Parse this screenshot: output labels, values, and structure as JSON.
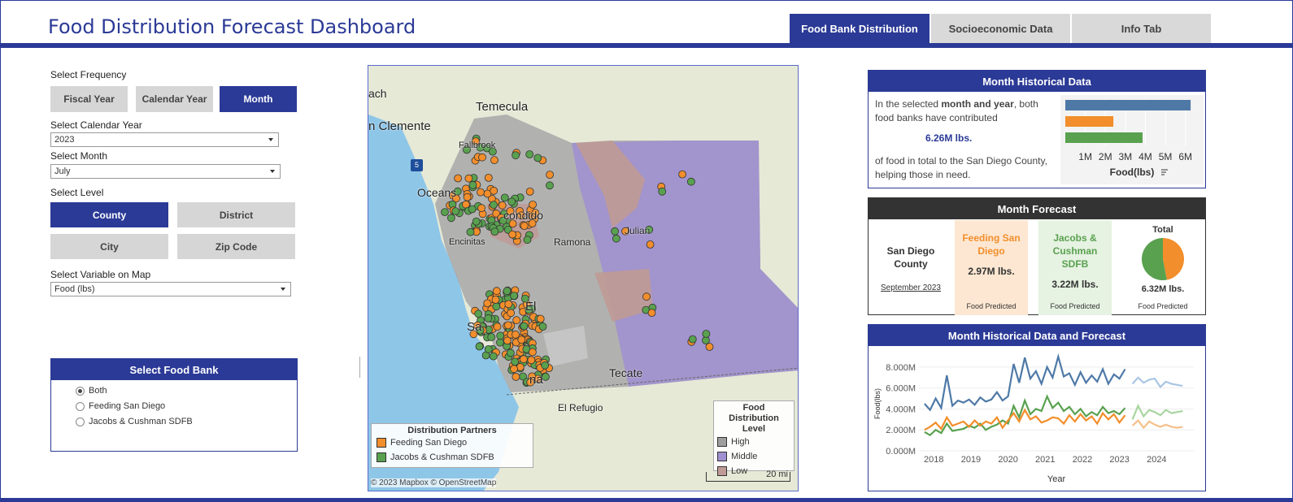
{
  "header": {
    "title": "Food Distribution Forecast Dashboard",
    "tabs": [
      {
        "label": "Food Bank Distribution",
        "active": true
      },
      {
        "label": "Socioeconomic Data",
        "active": false
      },
      {
        "label": "Info Tab",
        "active": false
      }
    ]
  },
  "controls": {
    "frequency_label": "Select Frequency",
    "frequency_options": [
      "Fiscal Year",
      "Calendar Year",
      "Month"
    ],
    "frequency_selected": "Month",
    "year_label": "Select Calendar Year",
    "year_value": "2023",
    "month_label": "Select Month",
    "month_value": "July",
    "level_label": "Select Level",
    "level_options": [
      "County",
      "District",
      "City",
      "Zip Code"
    ],
    "level_selected": "County",
    "variable_label": "Select Variable on Map",
    "variable_value": "Food (lbs)"
  },
  "food_bank": {
    "title": "Select Food Bank",
    "options": [
      "Both",
      "Feeding San Diego",
      "Jacobs & Cushman SDFB"
    ],
    "selected": "Both"
  },
  "map": {
    "places": {
      "temecula": "Temecula",
      "san_clemente": "n Clemente",
      "fallbrook": "Fallbrook",
      "oceanside": "Oceans",
      "escondido": "condido",
      "encinitas": "Encinitas",
      "ramona": "Ramona",
      "julian": "Julian",
      "el_cajon": "El",
      "san_diego": "Sa",
      "chula": "na",
      "tecate": "Tecate",
      "el_refugio": "El Refugio",
      "beach": "ach"
    },
    "interstate": "5",
    "partners_legend": {
      "title": "Distribution Partners",
      "items": [
        "Feeding San Diego",
        "Jacobs & Cushman SDFB"
      ]
    },
    "level_legend": {
      "title_line1": "Food Distribution",
      "title_line2": "Level",
      "items": [
        "High",
        "Middle",
        "Low"
      ]
    },
    "scale": "20 mi",
    "attribution": "© 2023 Mapbox  © OpenStreetMap",
    "colors": {
      "feeding": "#f28e2b",
      "jacobs": "#59a14f",
      "high": "#9e9e9e",
      "middle": "#a08fd1",
      "low": "#c09a95"
    }
  },
  "historical": {
    "title": "Month Historical Data",
    "text_before": "In the selected ",
    "text_bold": "month and year",
    "text_after": ", both food banks have contributed",
    "amount": "6.26M lbs.",
    "text_end": "of food in total to the San Diego County, helping those in need.",
    "axis_label": "Food(lbs)",
    "ticks": [
      "1M",
      "2M",
      "3M",
      "4M",
      "5M",
      "6M"
    ]
  },
  "forecast": {
    "title": "Month Forecast",
    "region_line1": "San Diego",
    "region_line2": "County",
    "period": "September 2023",
    "feeding_name_1": "Feeding San",
    "feeding_name_2": "Diego",
    "feeding_value": "2.97M lbs.",
    "jacobs_name_1": "Jacobs &",
    "jacobs_name_2": "Cushman SDFB",
    "jacobs_value": "3.22M lbs.",
    "total_label": "Total",
    "total_value": "6.32M lbs.",
    "caption": "Food Predicted",
    "pie_share_feeding": 0.47
  },
  "trend": {
    "title": "Month Historical Data and Forecast",
    "ylabel": "Food(lbs)",
    "xlabel": "Year"
  },
  "chart_data": [
    {
      "type": "bar",
      "orientation": "horizontal",
      "categories": [
        "Total",
        "Feeding San Diego",
        "Jacobs & Cushman SDFB"
      ],
      "values": [
        6.26,
        2.4,
        3.86
      ],
      "xlabel": "Food(lbs)",
      "ticks": [
        "1M",
        "2M",
        "3M",
        "4M",
        "5M",
        "6M"
      ],
      "xlim": [
        0,
        6.5
      ],
      "colors": [
        "#4e79a7",
        "#f28e2b",
        "#59a14f"
      ]
    },
    {
      "type": "line",
      "xlabel": "Year",
      "ylabel": "Food(lbs)",
      "x_ticks": [
        "2018",
        "2019",
        "2020",
        "2021",
        "2022",
        "2023",
        "2024"
      ],
      "y_ticks": [
        "0.000M",
        "2.000M",
        "4.000M",
        "6.000M",
        "8.000M"
      ],
      "xlim": [
        2017.6,
        2025.0
      ],
      "ylim": [
        0,
        9
      ],
      "series": [
        {
          "key": "total",
          "color": "#4e79a7",
          "forecast_color": "#a9c6e3",
          "x": [
            2017.75,
            2017.9,
            2018.05,
            2018.2,
            2018.35,
            2018.5,
            2018.65,
            2018.8,
            2018.95,
            2019.1,
            2019.25,
            2019.4,
            2019.55,
            2019.7,
            2019.85,
            2020.0,
            2020.15,
            2020.3,
            2020.45,
            2020.6,
            2020.75,
            2020.9,
            2021.05,
            2021.2,
            2021.35,
            2021.5,
            2021.65,
            2021.8,
            2021.95,
            2022.1,
            2022.25,
            2022.4,
            2022.55,
            2022.7,
            2022.85,
            2023.0,
            2023.15,
            2023.35,
            2023.5,
            2023.65,
            2023.8,
            2023.95,
            2024.1,
            2024.25,
            2024.4,
            2024.55,
            2024.7
          ],
          "y": [
            4.5,
            3.9,
            5.0,
            4.1,
            7.2,
            4.3,
            4.8,
            4.6,
            4.9,
            4.4,
            5.1,
            4.7,
            4.9,
            5.6,
            4.8,
            5.2,
            8.3,
            6.5,
            8.9,
            6.9,
            7.6,
            6.4,
            8.0,
            7.0,
            9.0,
            7.1,
            7.4,
            6.3,
            7.5,
            6.5,
            7.2,
            6.6,
            7.8,
            6.4,
            7.3,
            6.9,
            7.8,
            6.4,
            7.0,
            6.5,
            6.8,
            6.9,
            6.1,
            6.6,
            6.4,
            6.3,
            6.2
          ]
        },
        {
          "key": "jacobs",
          "color": "#59a14f",
          "forecast_color": "#a8d5a0",
          "x": [
            2017.75,
            2017.9,
            2018.05,
            2018.2,
            2018.35,
            2018.5,
            2018.65,
            2018.8,
            2018.95,
            2019.1,
            2019.25,
            2019.4,
            2019.55,
            2019.7,
            2019.85,
            2020.0,
            2020.15,
            2020.3,
            2020.45,
            2020.6,
            2020.75,
            2020.9,
            2021.05,
            2021.2,
            2021.35,
            2021.5,
            2021.65,
            2021.8,
            2021.95,
            2022.1,
            2022.25,
            2022.4,
            2022.55,
            2022.7,
            2022.85,
            2023.0,
            2023.15,
            2023.35,
            2023.5,
            2023.65,
            2023.8,
            2023.95,
            2024.1,
            2024.25,
            2024.4,
            2024.55,
            2024.7
          ],
          "y": [
            1.8,
            1.5,
            2.0,
            1.7,
            2.6,
            1.9,
            2.0,
            2.1,
            2.4,
            2.2,
            2.6,
            2.0,
            2.3,
            2.5,
            2.9,
            2.6,
            4.3,
            3.2,
            4.8,
            3.5,
            4.0,
            3.8,
            5.2,
            4.1,
            4.6,
            3.8,
            4.2,
            3.5,
            4.0,
            3.3,
            3.7,
            3.4,
            4.2,
            3.6,
            3.8,
            3.5,
            4.1,
            3.0,
            4.3,
            3.3,
            3.9,
            3.7,
            3.4,
            3.9,
            3.6,
            3.7,
            3.8
          ]
        },
        {
          "key": "feeding",
          "color": "#f28e2b",
          "forecast_color": "#f5c08a",
          "x": [
            2017.75,
            2017.9,
            2018.05,
            2018.2,
            2018.35,
            2018.5,
            2018.65,
            2018.8,
            2018.95,
            2019.1,
            2019.25,
            2019.4,
            2019.55,
            2019.7,
            2019.85,
            2020.0,
            2020.15,
            2020.3,
            2020.45,
            2020.6,
            2020.75,
            2020.9,
            2021.05,
            2021.2,
            2021.35,
            2021.5,
            2021.65,
            2021.8,
            2021.95,
            2022.1,
            2022.25,
            2022.4,
            2022.55,
            2022.7,
            2022.85,
            2023.0,
            2023.15,
            2023.35,
            2023.5,
            2023.65,
            2023.8,
            2023.95,
            2024.1,
            2024.25,
            2024.4,
            2024.55,
            2024.7
          ],
          "y": [
            2.0,
            2.3,
            2.7,
            2.1,
            3.2,
            2.4,
            2.6,
            2.8,
            2.3,
            2.9,
            2.4,
            2.8,
            2.6,
            3.2,
            2.2,
            2.9,
            3.6,
            2.8,
            3.9,
            3.0,
            3.3,
            2.7,
            2.9,
            3.2,
            3.1,
            2.6,
            3.4,
            2.8,
            3.5,
            2.9,
            3.3,
            2.6,
            3.6,
            3.0,
            3.5,
            2.7,
            3.4,
            2.4,
            2.9,
            2.2,
            2.8,
            2.5,
            2.3,
            2.5,
            2.3,
            2.2,
            2.3
          ]
        }
      ],
      "forecast_start": 2023.35
    }
  ]
}
